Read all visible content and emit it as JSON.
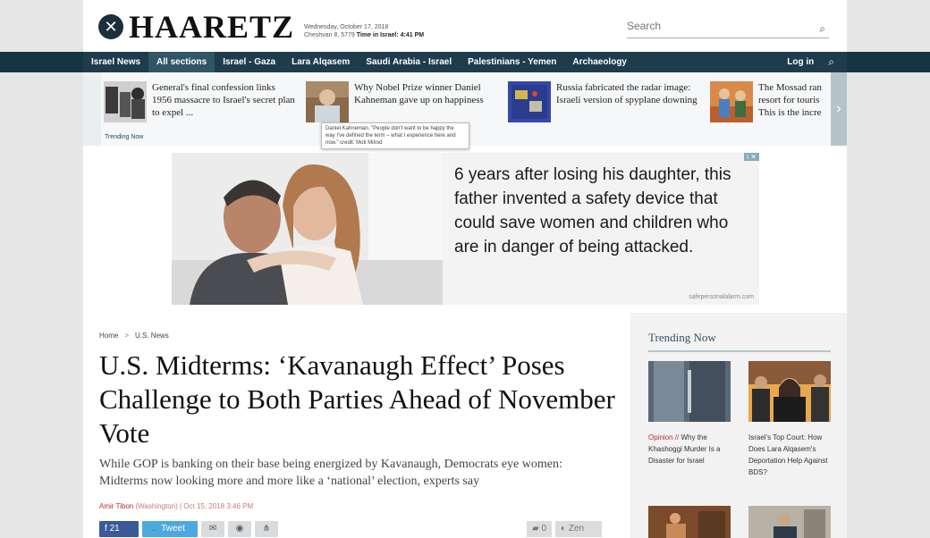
{
  "header": {
    "logo_mark": "✕",
    "logo_text": "HAARETZ",
    "date_line1": "Wednesday, October 17, 2018",
    "date_line2_plain": "Cheshvan 8, 5779 ",
    "date_line2_bold": "Time in Israel: 4:41 PM",
    "search_placeholder": "Search",
    "search_icon": "⌕"
  },
  "nav": {
    "items": [
      "Israel News",
      "All sections",
      "Israel - Gaza",
      "Lara Alqasem",
      "Saudi Arabia - Israel",
      "Palestinians - Yemen",
      "Archaeology"
    ],
    "login": "Log in",
    "search_icon": "⌕"
  },
  "strip": {
    "stories": [
      {
        "text": "General's final confession links 1956 massacre to Israel's secret plan to expel ..."
      },
      {
        "text": "Why Nobel Prize winner Daniel Kahneman gave up on happiness"
      },
      {
        "text": "Russia fabricated the radar image: Israeli version of spyplane downing"
      },
      {
        "text": "The Mossad ran resort for touris This is the incre"
      }
    ],
    "label": "Trending Now",
    "next": "›"
  },
  "tooltip": "Daniel Kahneman. \"People don't want to be happy the way I've defined the term – what I experience here and now.\" credit: Moti Milrod",
  "ad": {
    "text": "6 years after losing his daughter, this father invented a safety device that could save women and children who are in danger of being attacked.",
    "url": "safepersonalalarm.com",
    "badge": "i ✕"
  },
  "article": {
    "breadcrumb_home": "Home",
    "breadcrumb_sep": ">",
    "breadcrumb_section": "U.S. News",
    "headline": "U.S. Midterms: ‘Kavanaugh Effect’ Poses Challenge to Both Parties Ahead of November Vote",
    "dek": "While GOP is banking on their base being energized by Kavanaugh, Democrats eye women: Midterms now looking more and more like a ‘national’ election, experts say",
    "author": "Amir Tibon",
    "location": "Washington",
    "date": "Oct 15, 2018 3:46 PM",
    "fb_count": "21",
    "tweet_label": "Tweet",
    "comments": "0",
    "zen_label": "Zen"
  },
  "sidebar": {
    "title": "Trending Now",
    "cards": [
      {
        "op": "Opinion //",
        "caption": "Why the Khashoggi Murder Is a Disaster for Israel"
      },
      {
        "op": "",
        "caption": "Israel's Top Court: How Does Lara Alqasem's Deportation Help Against BDS?"
      }
    ]
  },
  "colors": {
    "nav_bg": "#1e3c4b",
    "accent_red": "#b03030",
    "facebook": "#3b5a9a",
    "twitter": "#4ea8e0"
  }
}
